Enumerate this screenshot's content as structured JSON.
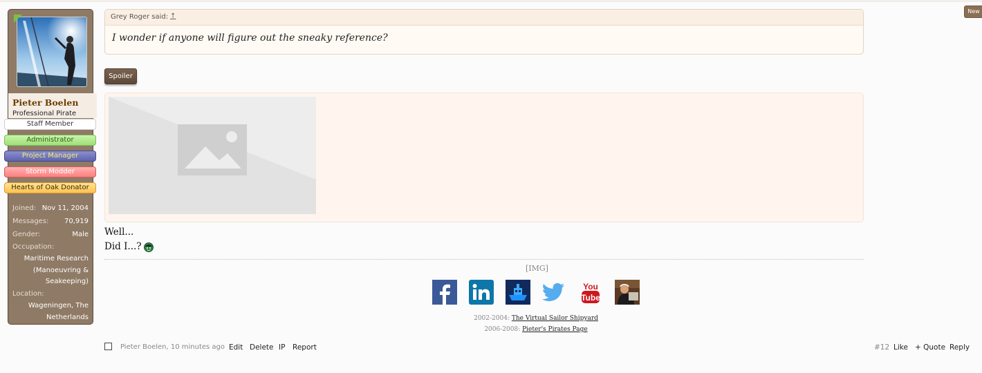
{
  "top_tab": {
    "label": "New"
  },
  "user": {
    "name": "Pieter Boelen",
    "title": "Professional Pirate",
    "banners": [
      "Staff Member",
      "Administrator",
      "Project Manager",
      "Storm Modder",
      "Hearts of Oak Donator"
    ],
    "joined_label": "Joined:",
    "joined_value": "Nov 11, 2004",
    "messages_label": "Messages:",
    "messages_value": "70,919",
    "gender_label": "Gender:",
    "gender_value": "Male",
    "occupation_label": "Occupation:",
    "occupation_lines": [
      "Maritime Research",
      "(Manoeuvring &",
      "Seakeeping)"
    ],
    "location_label": "Location:",
    "location_lines": [
      "Wageningen, The",
      "Netherlands"
    ]
  },
  "quote": {
    "attribution": "Grey Roger said:",
    "arrow": "↑",
    "text": "I wonder if anyone will figure out the sneaky reference?"
  },
  "spoiler": {
    "label": "Spoiler"
  },
  "post": {
    "line1": "Well...",
    "line2": "Did I...?"
  },
  "signature": {
    "img_tag": "[IMG]",
    "icons": [
      "facebook-icon",
      "linkedin-icon",
      "shipyard-icon",
      "twitter-icon",
      "youtube-icon",
      "portrait-icon"
    ],
    "line1_prefix": "2002-2004:",
    "line1_link": "The Virtual Sailor Shipyard",
    "line2_prefix": "2006-2008:",
    "line2_link": "Pieter's Pirates Page"
  },
  "footer": {
    "meta": "Pieter Boelen, 10 minutes ago",
    "edit": "Edit",
    "delete": "Delete",
    "ip": "IP",
    "report": "Report",
    "post_number": "#12",
    "like": "Like",
    "quote": "+ Quote",
    "reply": "Reply"
  }
}
